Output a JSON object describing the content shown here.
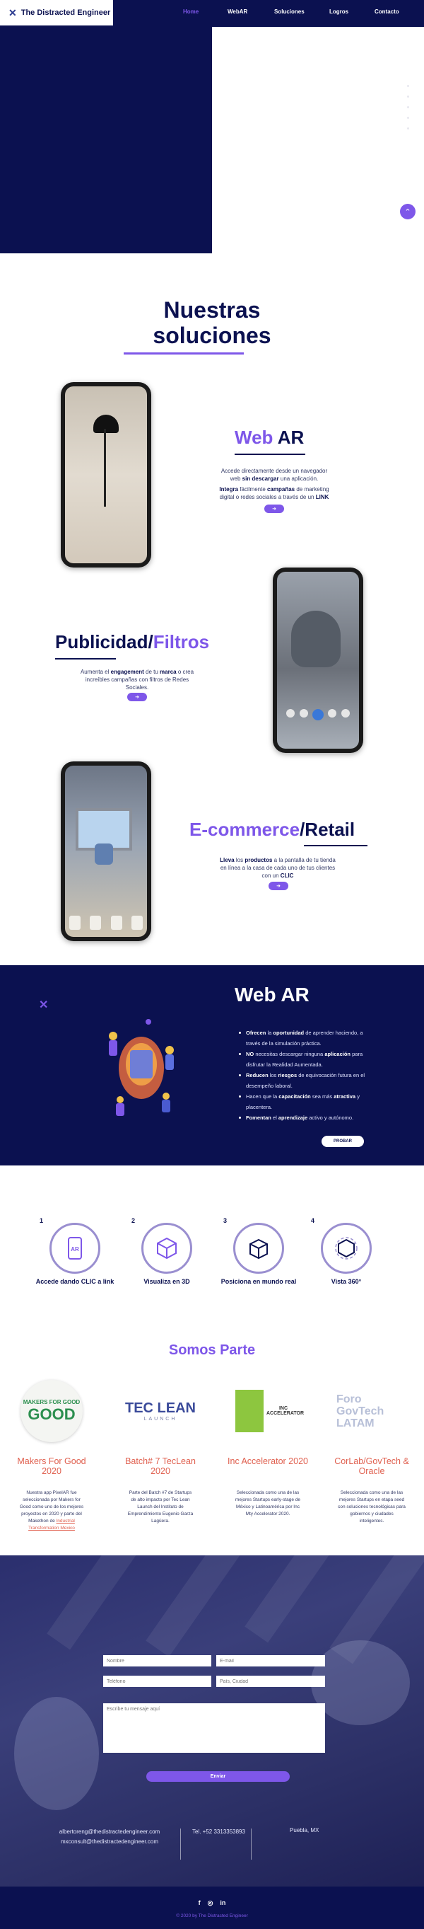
{
  "header": {
    "logo_text": "The Distracted Engineer",
    "nav": [
      "Home",
      "WebAR",
      "Soluciones",
      "Logros",
      "Contacto"
    ]
  },
  "colors": {
    "navy": "#0b1150",
    "accent": "#7e57e9",
    "coral": "#e0604f"
  },
  "solutions": {
    "title_line1": "Nuestras",
    "title_line2": "soluciones",
    "items": [
      {
        "heading_a": "Web",
        "heading_b": "AR",
        "desc_pre": "Accede directamente desde un navegador web ",
        "desc_bold": "sin descargar",
        "desc_post": " una aplicación.",
        "desc2_bold1": "Integra",
        "desc2_mid": " fácilmente ",
        "desc2_bold2": "campañas",
        "desc2_post": " de marketing digital o redes sociales a través de un ",
        "desc2_bold3": "LINK"
      },
      {
        "heading_a": "Publicidad/",
        "heading_b": "Filtros",
        "desc_pre": "Aumenta el ",
        "desc_bold": "engagement",
        "desc_mid": " de tu ",
        "desc_bold2": "marca",
        "desc_post": " o crea increíbles campañas con filtros de Redes Sociales."
      },
      {
        "heading_a": "E-commerce",
        "heading_b": "/Retail",
        "desc_pre": "Lleva",
        "desc_mid": " los ",
        "desc_bold": "productos",
        "desc_post": " a la pantalla de tu tienda en línea a la casa de cada uno de tus clientes con un ",
        "desc_bold2": "CLIC"
      }
    ],
    "arrow": "➜"
  },
  "webar": {
    "title": "Web AR",
    "bullets": [
      {
        "pre": "",
        "bold": "Ofrecen",
        "post": " la ",
        "bold2": "oportunidad",
        "post2": " de aprender haciendo, a través de la simulación práctica."
      },
      {
        "pre": "",
        "bold": "NO",
        "post": " necesitas descargar ninguna ",
        "bold2": "aplicación",
        "post2": " para disfrutar la Realidad Aumentada."
      },
      {
        "pre": "",
        "bold": "Reducen",
        "post": " los ",
        "bold2": "riesgos",
        "post2": " de equivocación futura en el desempeño laboral."
      },
      {
        "pre": "Hacen que la ",
        "bold": "capacitación",
        "post": " sea más ",
        "bold2": "atractiva",
        "post2": " y placentera."
      },
      {
        "pre": "",
        "bold": "Fomentan",
        "post": " el ",
        "bold2": "aprendizaje",
        "post2": " activo y autónomo."
      }
    ],
    "button": "PROBAR"
  },
  "steps": [
    {
      "num": "1",
      "label": "Accede dando CLIC a link",
      "icon": "phone-ar-icon"
    },
    {
      "num": "2",
      "label": "Visualiza en 3D",
      "icon": "cube-3d-icon"
    },
    {
      "num": "3",
      "label": "Posiciona en mundo real",
      "icon": "box-place-icon"
    },
    {
      "num": "4",
      "label": "Vista 360°",
      "icon": "rotate-360-icon"
    }
  ],
  "partners": {
    "title": "Somos Parte",
    "items": [
      {
        "name": "Makers For Good 2020",
        "logo_text": "MAKERS FOR GOOD",
        "desc": "Nuestra app PixelAR fue seleccionada por Makers for Good como uno de los mejores proyectos en 2020 y parte del Makethon de ",
        "link": "Industrial Transformation Mexico"
      },
      {
        "name": "Batch# 7 TecLean 2020",
        "logo_text": "TEC LEAN",
        "logo_sub": "LAUNCH",
        "desc": "Parte del Batch #7 de Startups de alto impacto por Tec Lean Launch del Instituto de Emprendimiento Eugenio Garza Lagüera."
      },
      {
        "name": "Inc Accelerator 2020",
        "logo_text": "INC ACCELERATOR",
        "desc": "Seleccionada como una de las mejores Startups early-stage de México y Latinoamérica por Inc Mty Accelerator 2020."
      },
      {
        "name": "CorLab/GovTech & Oracle",
        "logo_text": "Foro GovTech LATAM",
        "desc": "Seleccionada como una de las mejores Startups en etapa seed con soluciones tecnológicas para gobiernos y ciudades inteligentes."
      }
    ]
  },
  "contact": {
    "placeholders": {
      "name": "Nombre",
      "email": "E-mail",
      "phone": "Teléfono",
      "city": "País, Ciudad",
      "message": "Escribe tu mensaje aquí"
    },
    "send": "Enviar",
    "email1": "albertoreng@thedistractedengineer.com",
    "email2": "mxconsult@thedistractedengineer.com",
    "phone": "Tel. +52 3313353893",
    "location": "Puebla, MX"
  },
  "footer": {
    "social": [
      "f",
      "◎",
      "in"
    ],
    "copyright": "© 2020 by The Distracted Engineer"
  }
}
